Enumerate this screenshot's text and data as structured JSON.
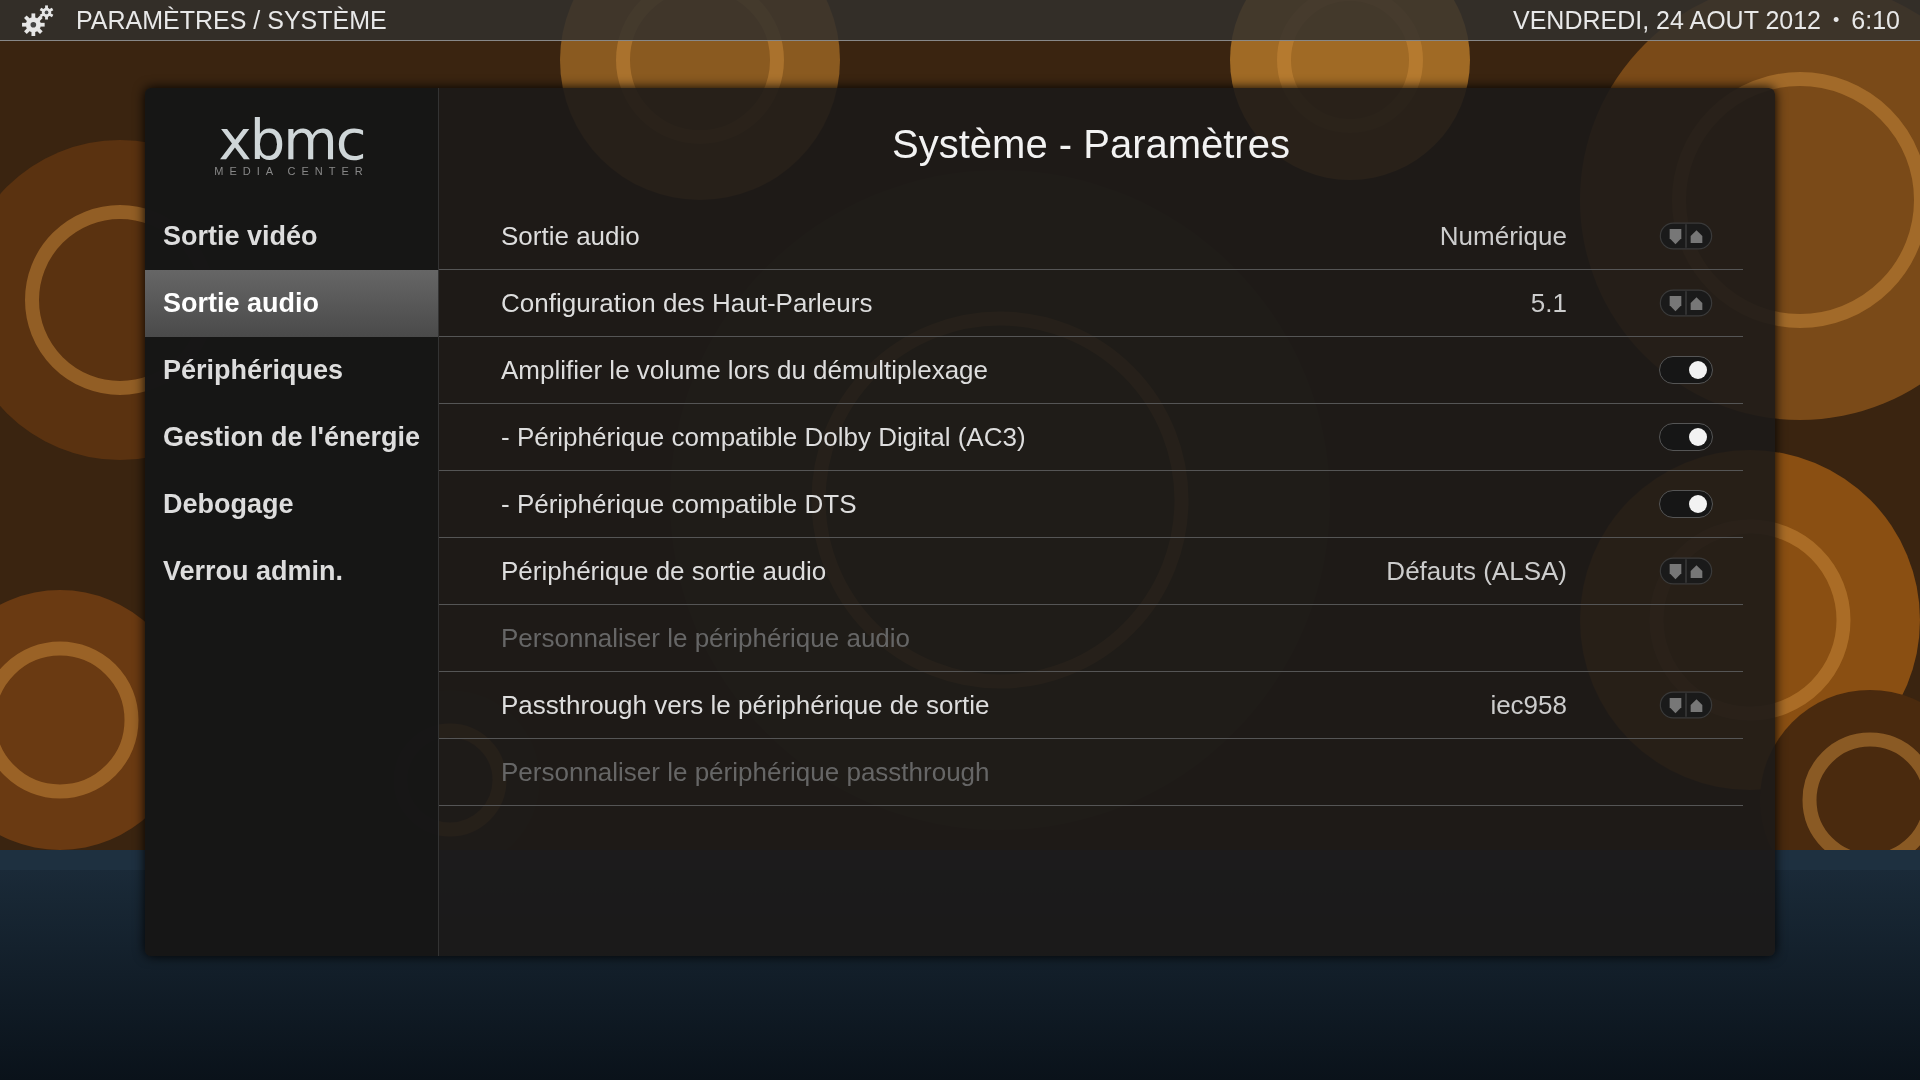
{
  "top_bar": {
    "title": "PARAMÈTRES / SYSTÈME",
    "date": "VENDREDI, 24 AOUT 2012",
    "separator": "•",
    "time": "6:10"
  },
  "logo": {
    "wordmark": "xbmc",
    "tagline": "MEDIA CENTER"
  },
  "sidebar": {
    "items": [
      {
        "label": "Sortie vidéo",
        "selected": false
      },
      {
        "label": "Sortie audio",
        "selected": true
      },
      {
        "label": "Périphériques",
        "selected": false
      },
      {
        "label": "Gestion de l'énergie",
        "selected": false
      },
      {
        "label": "Debogage",
        "selected": false
      },
      {
        "label": "Verrou admin.",
        "selected": false
      }
    ]
  },
  "panel": {
    "title": "Système - Paramètres"
  },
  "settings": [
    {
      "label": "Sortie audio",
      "value": "Numérique",
      "kind": "spinner",
      "disabled": false
    },
    {
      "label": "Configuration des Haut-Parleurs",
      "value": "5.1",
      "kind": "spinner",
      "disabled": false
    },
    {
      "label": "Amplifier le volume lors du démultiplexage",
      "kind": "toggle",
      "on": true,
      "disabled": false
    },
    {
      "label": "- Périphérique compatible Dolby Digital (AC3)",
      "kind": "toggle",
      "on": true,
      "disabled": false
    },
    {
      "label": "- Périphérique compatible DTS",
      "kind": "toggle",
      "on": true,
      "disabled": false
    },
    {
      "label": "Périphérique de sortie audio",
      "value": "Défauts (ALSA)",
      "kind": "spinner",
      "disabled": false
    },
    {
      "label": "Personnaliser le périphérique audio",
      "kind": "plain",
      "disabled": true
    },
    {
      "label": "Passthrough vers le périphérique de sortie",
      "value": "iec958",
      "kind": "spinner",
      "disabled": false
    },
    {
      "label": "Personnaliser le périphérique passthrough",
      "kind": "plain",
      "disabled": true
    }
  ]
}
